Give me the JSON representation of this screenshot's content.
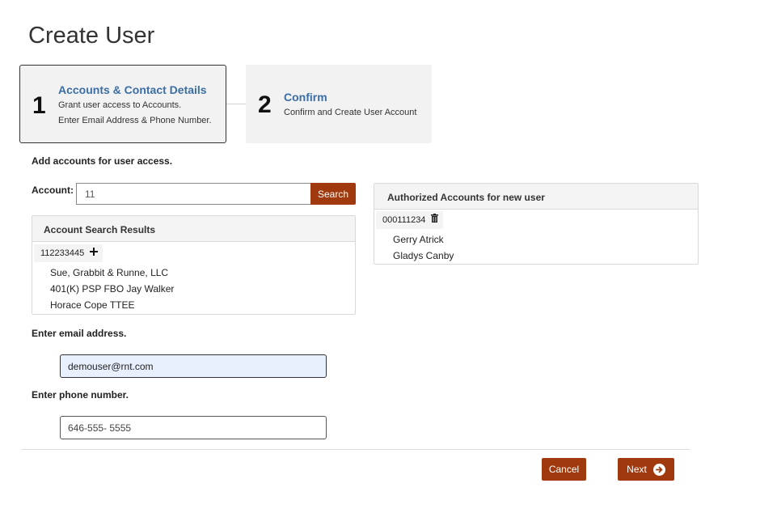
{
  "page": {
    "title": "Create User"
  },
  "steps": [
    {
      "number": "1",
      "title": "Accounts & Contact Details",
      "desc1": "Grant user access to Accounts.",
      "desc2": "Enter Email Address & Phone Number."
    },
    {
      "number": "2",
      "title": "Confirm",
      "desc1": "Confirm and Create User Account"
    }
  ],
  "accounts": {
    "section_label": "Add accounts for user access.",
    "account_label": "Account:",
    "account_value": "11",
    "search_label": "Search"
  },
  "search_results": {
    "header": "Account Search Results",
    "account_number": "112233445",
    "add_icon": "plus-icon",
    "holders": [
      "Sue, Grabbit & Runne, LLC",
      "401(K) PSP FBO Jay Walker",
      "Horace Cope TTEE"
    ]
  },
  "authorized": {
    "header": "Authorized Accounts for new user",
    "account_number": "000111234",
    "remove_icon": "trash-icon",
    "holders": [
      "Gerry Atrick",
      "Gladys Canby"
    ]
  },
  "contact": {
    "email_label": "Enter email address.",
    "email_value": "demouser@rnt.com",
    "phone_label": "Enter phone number.",
    "phone_value": "646-555- 5555"
  },
  "footer": {
    "cancel_label": "Cancel",
    "next_label": "Next",
    "next_icon": "arrow-right-circle-icon"
  },
  "colors": {
    "accent": "#a03a0e",
    "step_title": "#3a6ea5",
    "email_bg": "#e8f0fe"
  }
}
